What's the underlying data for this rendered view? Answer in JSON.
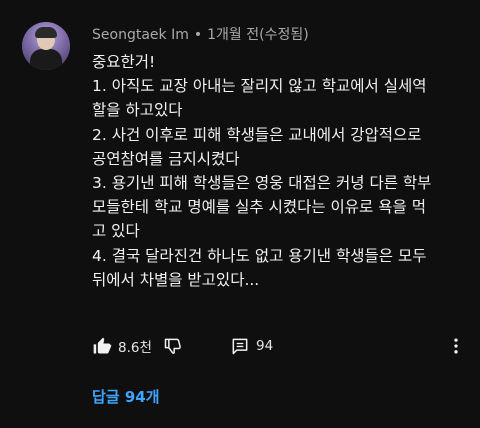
{
  "comment": {
    "author": "Seongtaek Im",
    "separator": "•",
    "time": "1개월 전(수정됨)",
    "lines": [
      "중요한거!",
      "1. 아직도 교장 아내는 잘리지 않고 학교에서 실세역",
      "할을 하고있다",
      "2. 사건 이후로 피해 학생들은 교내에서 강압적으로",
      "공연참여를 금지시켰다",
      "3. 용기낸 피해 학생들은 영웅 대접은 커녕 다른 학부",
      "모들한테 학교 명예를 실추 시켰다는 이유로 욕을 먹",
      "고 있다",
      "4. 결국 달라진건 하나도 없고 용기낸 학생들은 모두",
      "뒤에서 차별을 받고있다..."
    ]
  },
  "actions": {
    "like_icon": "thumb-up-icon",
    "like_count": "8.6천",
    "dislike_icon": "thumb-down-icon",
    "reply_icon": "comment-icon",
    "reply_count": "94",
    "more_icon": "more-vertical-icon"
  },
  "replies": {
    "label": "답글 94개"
  },
  "colors": {
    "background": "#0f0f0f",
    "text": "#f1f1f1",
    "meta": "#aaaaaa",
    "link": "#3ea6ff"
  }
}
